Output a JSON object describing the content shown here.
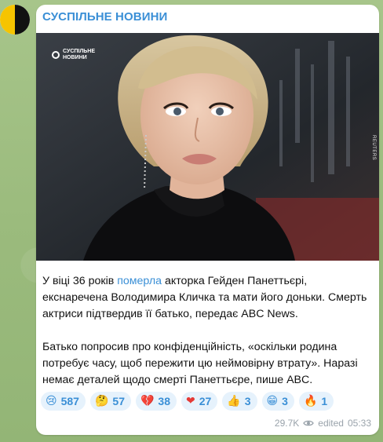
{
  "channel": {
    "name": "СУСПІЛЬНЕ НОВИНИ"
  },
  "photo": {
    "watermark_line1": "СУСПІЛЬНЕ",
    "watermark_line2": "НОВИНИ",
    "credit": "REUTERS"
  },
  "post": {
    "p1_before": "У віці 36 років ",
    "p1_link": "померла",
    "p1_after": " акторка Гейден Панеттьєрі, екснаречена Володимира Кличка та мати його доньки. Смерть актриси підтвердив її батько, передає ABC News.",
    "p2": "Батько попросив про конфіденційність, «оскільки родина потребує часу, щоб пережити цю неймовірну втрату». Наразі немає деталей щодо смерті Панеттьєре, пише ABC."
  },
  "reactions": [
    {
      "icon": "crying-face-icon",
      "emoji": "😢",
      "count": "587"
    },
    {
      "icon": "thinking-face-icon",
      "emoji": "🤔",
      "count": "57"
    },
    {
      "icon": "broken-heart-icon",
      "emoji": "💔",
      "count": "38"
    },
    {
      "icon": "red-heart-icon",
      "emoji": "❤",
      "count": "27"
    },
    {
      "icon": "thumbs-up-icon",
      "emoji": "👍",
      "count": "3"
    },
    {
      "icon": "grinning-face-icon",
      "emoji": "😁",
      "count": "3"
    },
    {
      "icon": "fire-icon",
      "emoji": "🔥",
      "count": "1"
    }
  ],
  "meta": {
    "views": "29.7K",
    "edited": "edited",
    "time": "05:33"
  },
  "colors": {
    "accent": "#3a8fd6",
    "reaction_bg": "#e6f2fc",
    "avatar_yellow": "#f6c400"
  }
}
